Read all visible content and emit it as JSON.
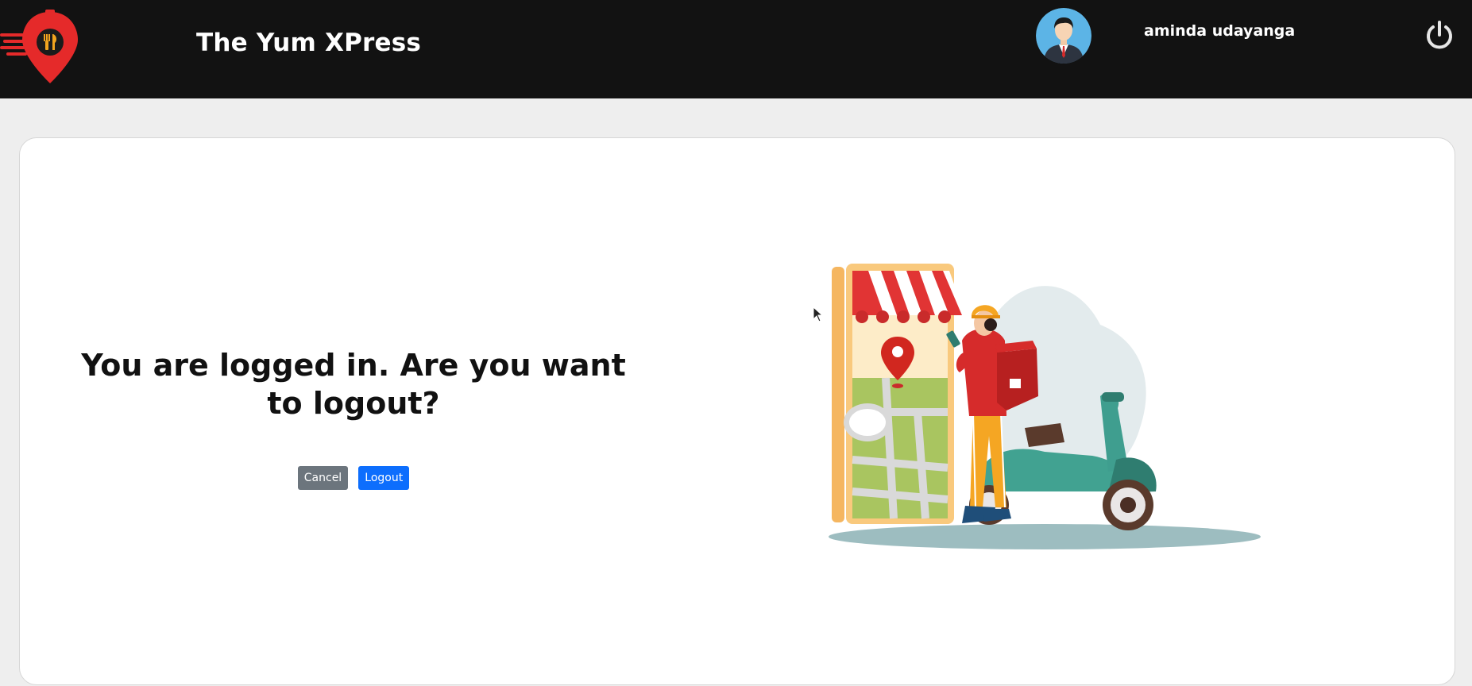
{
  "header": {
    "app_title": "The Yum XPress",
    "username": "aminda udayanga",
    "logo_icon": "food-delivery-pin-logo",
    "avatar_icon": "businessman-avatar",
    "power_icon": "power-icon"
  },
  "main": {
    "message": "You are logged in. Are you want to logout?",
    "cancel_label": "Cancel",
    "logout_label": "Logout",
    "illustration": "delivery-person-with-scooter-and-phone-map"
  },
  "colors": {
    "topbar": "#121212",
    "page_bg": "#eeeeee",
    "card_bg": "#ffffff",
    "cancel_button": "#6c757d",
    "logout_button": "#0d6efd",
    "brand_red": "#e52a2a"
  }
}
